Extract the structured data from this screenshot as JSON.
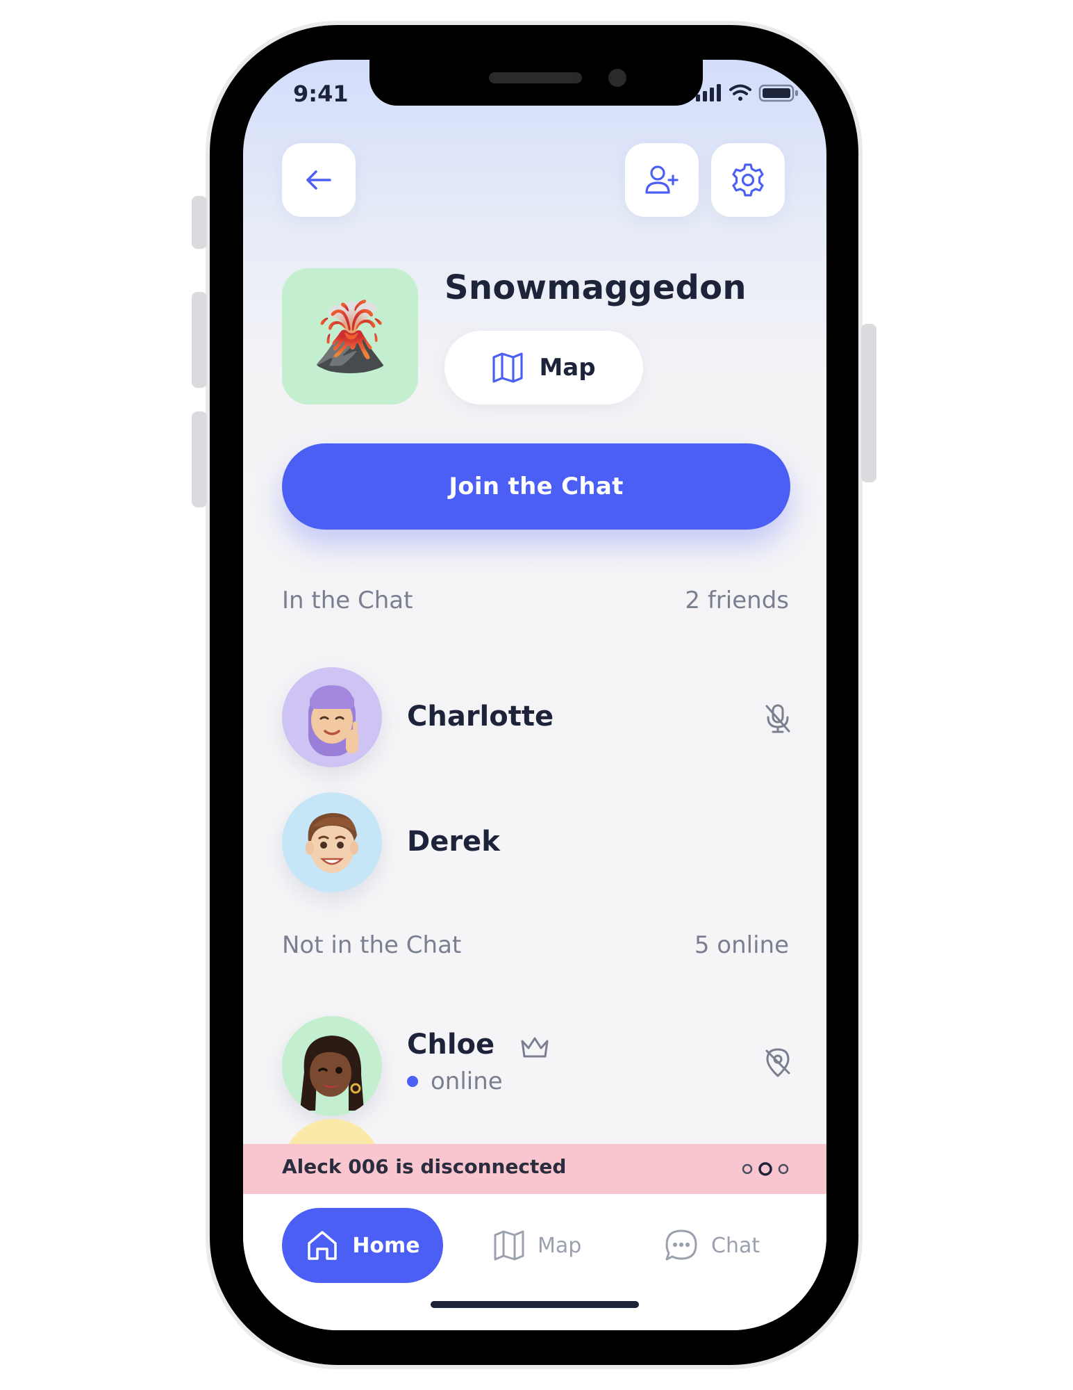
{
  "status_bar": {
    "time": "9:41"
  },
  "header": {
    "back_icon": "arrow-left-icon",
    "add_friend_icon": "user-plus-icon",
    "settings_icon": "gear-icon"
  },
  "group": {
    "title": "Snowmaggedon",
    "emoji": "🌋",
    "icon_bg": "#c3efd0",
    "map_button_label": "Map"
  },
  "join_button_label": "Join the Chat",
  "in_chat": {
    "label": "In the Chat",
    "count": "2 friends",
    "members": [
      {
        "name": "Charlotte",
        "avatar_bg": "#cfc3f4",
        "status_icon": "mic-off-icon"
      },
      {
        "name": "Derek",
        "avatar_bg": "#c6e6f8"
      }
    ]
  },
  "not_in_chat": {
    "label": "Not in the Chat",
    "count": "5 online",
    "members": [
      {
        "name": "Chloe",
        "badge_icon": "crown-icon",
        "status": "online",
        "avatar_bg": "#c3efd0",
        "status_icon": "location-off-icon"
      }
    ]
  },
  "alert": {
    "text": "Aleck 006 is disconnected",
    "bg": "#f9c5cf"
  },
  "nav": {
    "items": [
      {
        "label": "Home",
        "icon": "home-icon",
        "active": true
      },
      {
        "label": "Map",
        "icon": "map-icon"
      },
      {
        "label": "Chat",
        "icon": "chat-bubble-icon"
      }
    ]
  },
  "colors": {
    "accent": "#4b5ff4",
    "text": "#1d2339",
    "muted": "#7a7f90"
  }
}
